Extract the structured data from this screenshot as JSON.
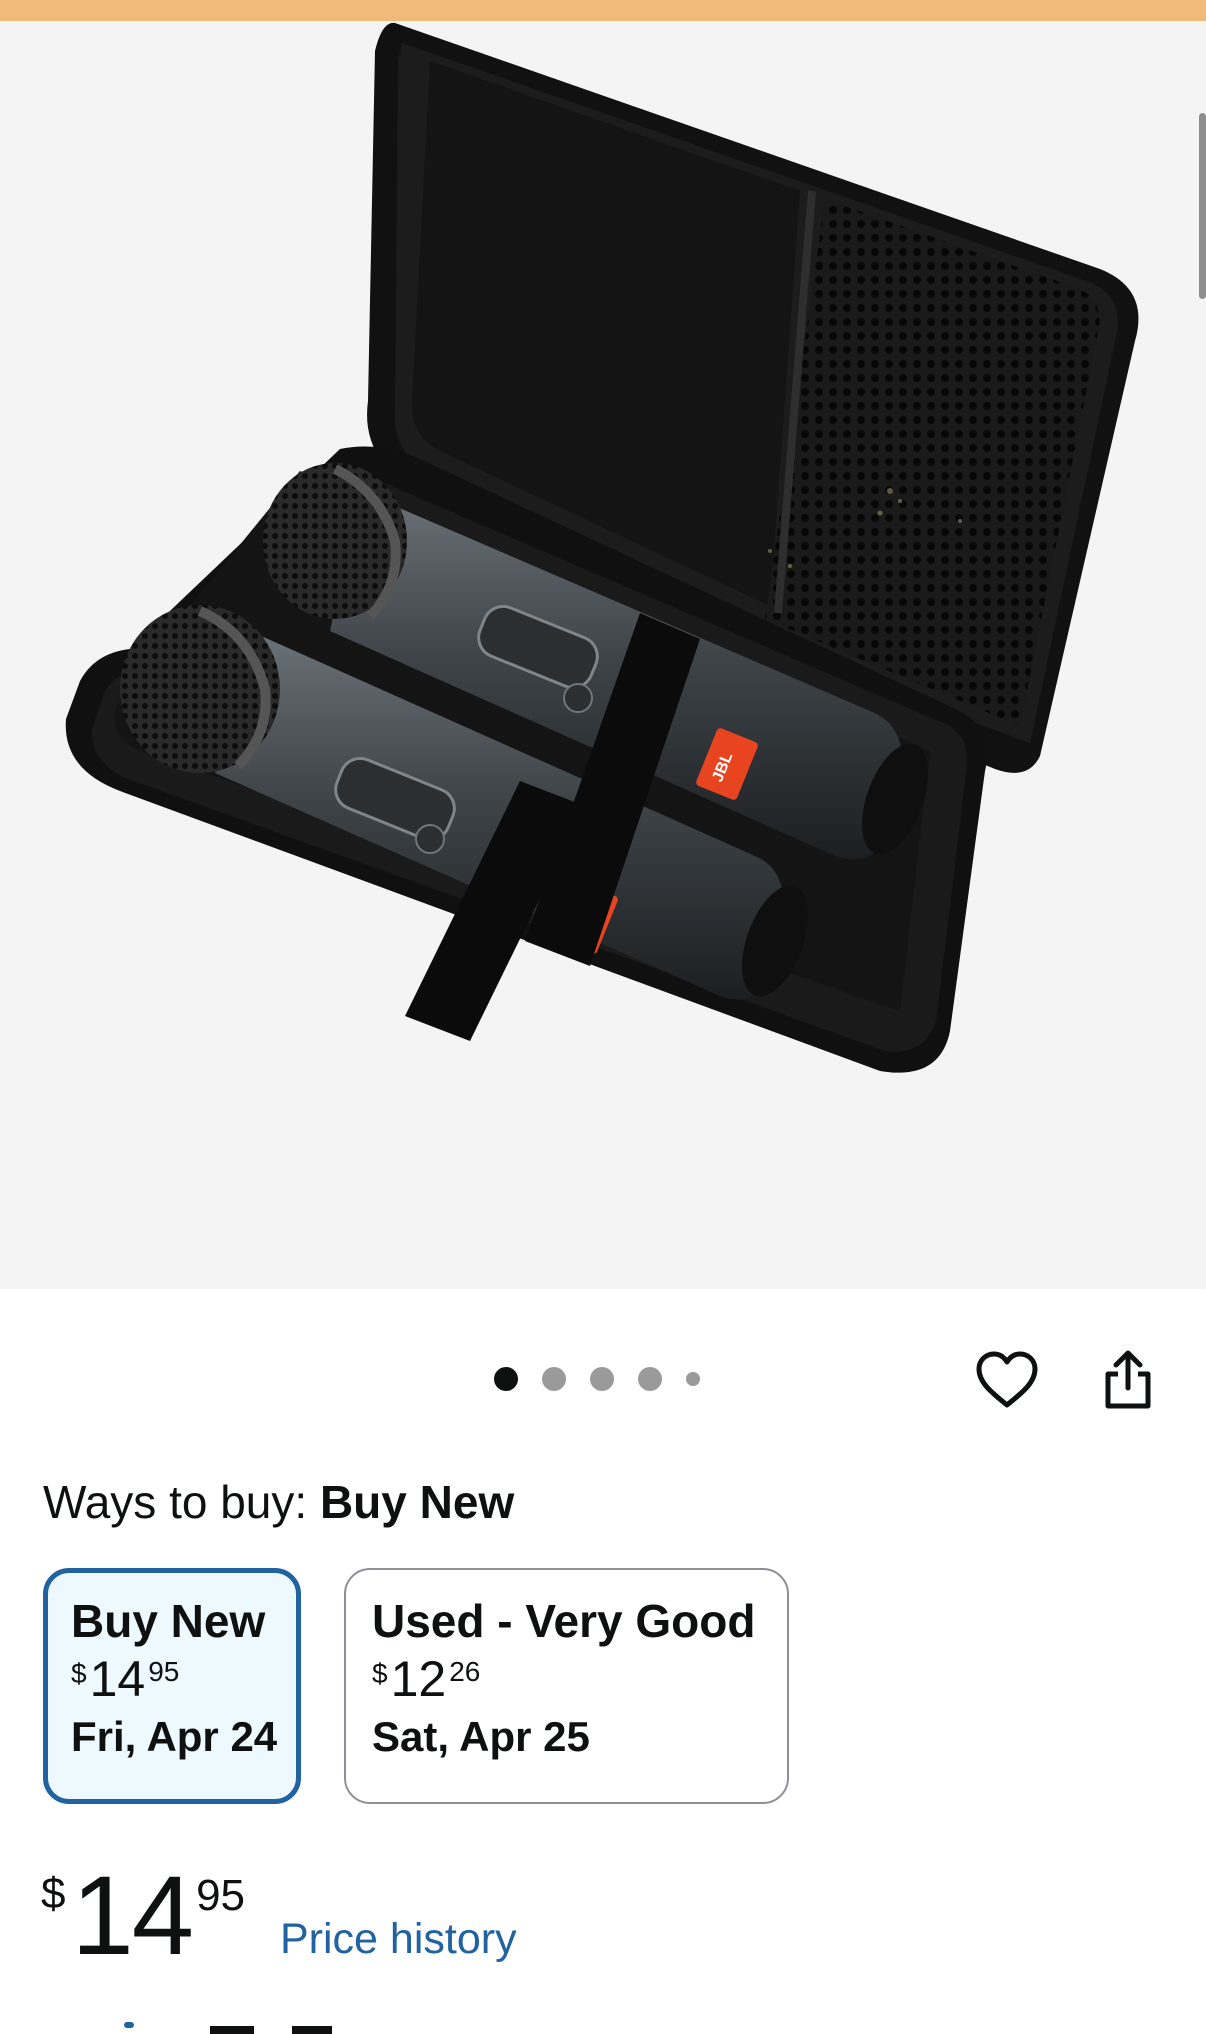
{
  "product_image": {
    "alt": "",
    "brand_mark": "JBL",
    "image_count": 5,
    "active_index": 0
  },
  "actions": {
    "favorite_icon": "heart-outline-icon",
    "share_icon": "share-icon"
  },
  "ways_to_buy": {
    "label": "Ways to buy:",
    "selected": "Buy New"
  },
  "options": [
    {
      "title": "Buy New",
      "currency": "$",
      "price_whole": "14",
      "price_fraction": "95",
      "delivery": "Fri, Apr 24",
      "selected": true
    },
    {
      "title": "Used - Very Good",
      "currency": "$",
      "price_whole": "12",
      "price_fraction": "26",
      "delivery": "Sat, Apr 25",
      "selected": false
    }
  ],
  "price": {
    "currency": "$",
    "whole": "14",
    "fraction": "95",
    "history_link": "Price history"
  },
  "colors": {
    "top_band": "#efba7a",
    "link_blue": "#2162a1",
    "selected_border": "#2162a1",
    "selected_bg": "#edf8ff",
    "jbl_red": "#e8441f"
  }
}
